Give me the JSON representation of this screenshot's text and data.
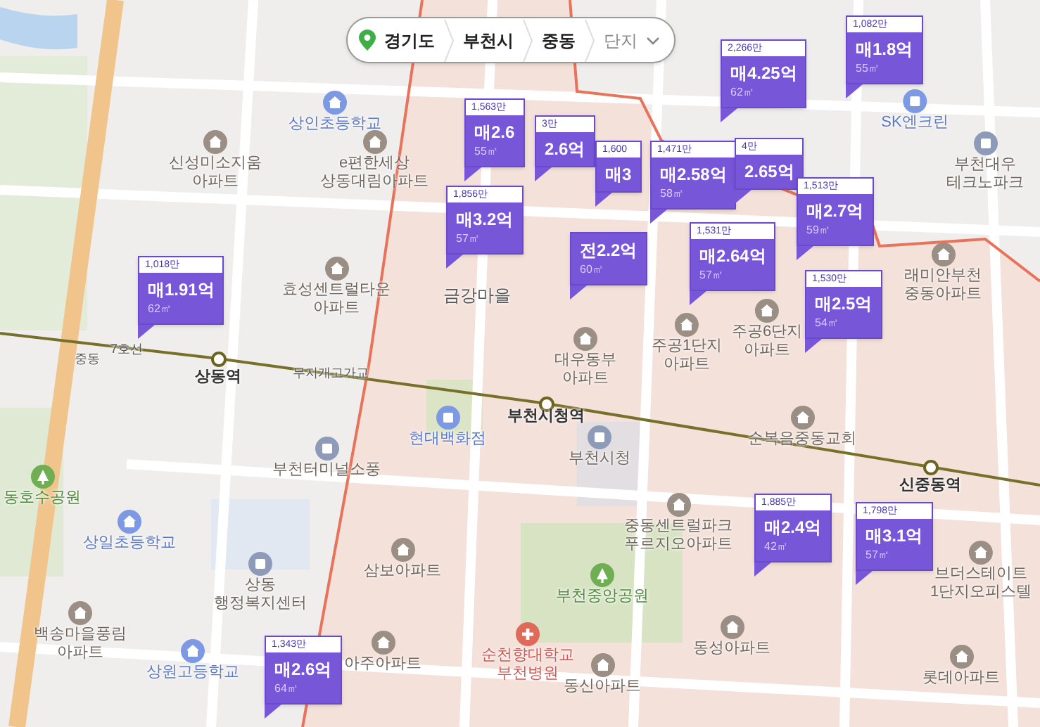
{
  "breadcrumb": {
    "levels": [
      "경기도",
      "부천시",
      "중동"
    ],
    "dropdown": "단지"
  },
  "places": [
    {
      "lines": [
        "상인초등학교"
      ],
      "kind": "school"
    },
    {
      "lines": [
        "신성미소지움",
        "아파트"
      ],
      "kind": "apartment"
    },
    {
      "lines": [
        "e편한세상",
        "상동대림아파트"
      ],
      "kind": "apartment"
    },
    {
      "lines": [
        "효성센트럴타운",
        "아파트"
      ],
      "kind": "apartment"
    },
    {
      "lines": [
        "금강마을"
      ],
      "kind": "place"
    },
    {
      "lines": [
        "SK엔크린"
      ],
      "kind": "store"
    },
    {
      "lines": [
        "부천대우",
        "테크노파크"
      ],
      "kind": "office"
    },
    {
      "lines": [
        "래미안부천",
        "중동아파트"
      ],
      "kind": "apartment"
    },
    {
      "lines": [
        "주공1단지",
        "아파트"
      ],
      "kind": "apartment"
    },
    {
      "lines": [
        "주공6단지",
        "아파트"
      ],
      "kind": "apartment"
    },
    {
      "lines": [
        "중동"
      ],
      "kind": "road"
    },
    {
      "lines": [
        "7호선"
      ],
      "kind": "road"
    },
    {
      "lines": [
        "상동역"
      ],
      "kind": "station"
    },
    {
      "lines": [
        "무지개고가교"
      ],
      "kind": "road"
    },
    {
      "lines": [
        "대우동부",
        "아파트"
      ],
      "kind": "apartment"
    },
    {
      "lines": [
        "부천시청역"
      ],
      "kind": "station"
    },
    {
      "lines": [
        "현대백화점"
      ],
      "kind": "store"
    },
    {
      "lines": [
        "부천터미널소풍"
      ],
      "kind": "bus"
    },
    {
      "lines": [
        "부천시청"
      ],
      "kind": "office"
    },
    {
      "lines": [
        "순복음중동교회"
      ],
      "kind": "church"
    },
    {
      "lines": [
        "신중동역"
      ],
      "kind": "station"
    },
    {
      "lines": [
        "동호수공원"
      ],
      "kind": "park"
    },
    {
      "lines": [
        "상일초등학교"
      ],
      "kind": "school"
    },
    {
      "lines": [
        "중동센트럴파크",
        "푸르지오아파트"
      ],
      "kind": "apartment"
    },
    {
      "lines": [
        "상동",
        "행정복지센터"
      ],
      "kind": "office"
    },
    {
      "lines": [
        "삼보아파트"
      ],
      "kind": "apartment"
    },
    {
      "lines": [
        "부천중앙공원"
      ],
      "kind": "park"
    },
    {
      "lines": [
        "브더스테이트",
        "1단지오피스텔"
      ],
      "kind": "apartment"
    },
    {
      "lines": [
        "백송마을풍림",
        "아파트"
      ],
      "kind": "apartment"
    },
    {
      "lines": [
        "상원고등학교"
      ],
      "kind": "school"
    },
    {
      "lines": [
        "아주아파트"
      ],
      "kind": "apartment"
    },
    {
      "lines": [
        "순천향대학교",
        "부천병원"
      ],
      "kind": "hospital"
    },
    {
      "lines": [
        "동성아파트"
      ],
      "kind": "apartment"
    },
    {
      "lines": [
        "동신아파트"
      ],
      "kind": "apartment"
    },
    {
      "lines": [
        "롯데아파트"
      ],
      "kind": "apartment"
    }
  ],
  "markers": [
    {
      "header": "1,018만",
      "price": "매1.91억",
      "area": "62㎡"
    },
    {
      "header": "1,563만",
      "price": "매2.6",
      "area": "55㎡"
    },
    {
      "header": "3만",
      "price": "2.6억"
    },
    {
      "header": "1,856만",
      "price": "매3.2억",
      "area": "57㎡"
    },
    {
      "header": "2,266만",
      "price": "매4.25억",
      "area": "62㎡"
    },
    {
      "header": "1,082만",
      "price": "매1.8억",
      "area": "55㎡"
    },
    {
      "header": "1,600",
      "price": "매3"
    },
    {
      "header": "1,471만",
      "price": "매2.58억",
      "area": "58㎡"
    },
    {
      "header": "4만",
      "price": "2.65억"
    },
    {
      "header": "1,513만",
      "price": "매2.7억",
      "area": "59㎡"
    },
    {
      "price": "전2.2억",
      "area": "60㎡"
    },
    {
      "header": "1,531만",
      "price": "매2.64억",
      "area": "57㎡"
    },
    {
      "header": "1,530만",
      "price": "매2.5억",
      "area": "54㎡"
    },
    {
      "header": "1,885만",
      "price": "매2.4억",
      "area": "42㎡"
    },
    {
      "header": "1,798만",
      "price": "매3.1억",
      "area": "57㎡"
    },
    {
      "header": "1,343만",
      "price": "매2.6억",
      "area": "64㎡"
    }
  ]
}
